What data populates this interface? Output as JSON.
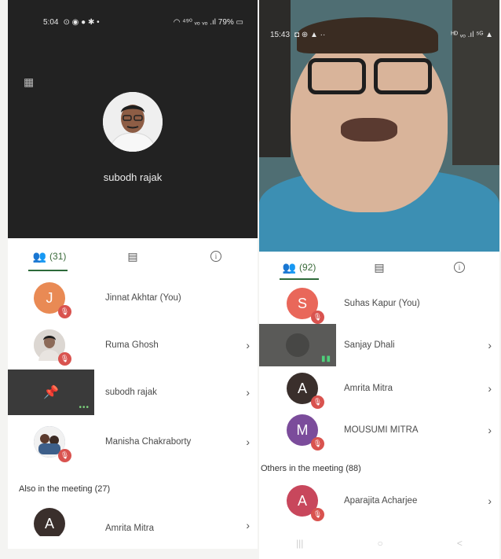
{
  "left_phone": {
    "status": {
      "time": "5:04",
      "icons_left": "⊙ ◉ ● ✱ •",
      "icons_right": "◠ ⁴⁹⁰ ᵥₒ ᵥₒ .ıl 79% ▭"
    },
    "presenter_name": "subodh rajak",
    "tabs": {
      "participants": "(31)"
    },
    "participants": [
      {
        "initial": "J",
        "name": "Jinnat Akhtar (You)",
        "color": "#e98a54"
      },
      {
        "initial": "",
        "name": "Ruma Ghosh",
        "color": "#d9d4cf"
      },
      {
        "initial": "",
        "name": "subodh rajak",
        "color": "#3a3a3a"
      },
      {
        "initial": "",
        "name": "Manisha Chakraborty",
        "color": "#6b7f9a"
      }
    ],
    "also_header": "Also in the meeting (27)",
    "partial_row": {
      "initial": "A",
      "name": "Amrita Mitra"
    }
  },
  "right_phone": {
    "status": {
      "time": "15:43",
      "icons_left": "◘ ⊕ ▲ ··",
      "icons_right": "ᴴᴰ ᵥₒ .ıl ⁵ᴳ ▲"
    },
    "tabs": {
      "participants": "(92)"
    },
    "participants": [
      {
        "initial": "S",
        "name": "Suhas Kapur (You)",
        "color": "#e9675a"
      },
      {
        "initial": "",
        "name": "Sanjay Dhali",
        "color": "#3a3a3a"
      },
      {
        "initial": "A",
        "name": "Amrita Mitra",
        "color": "#3a2f2c"
      },
      {
        "initial": "M",
        "name": "MOUSUMI MITRA",
        "color": "#7b4c9b"
      }
    ],
    "others_header": "Others in the meeting (88)",
    "others": [
      {
        "initial": "A",
        "name": "Aparajita Acharjee",
        "color": "#c8475c"
      }
    ],
    "nav": {
      "recents": "|||",
      "home": "○",
      "back": "<"
    }
  },
  "icons": {
    "participants": "participants-icon",
    "chat": "chat-icon",
    "info": "info-icon",
    "mic_off": "mic-off-icon",
    "chevron": "chevron-right-icon",
    "pin": "pin-icon"
  },
  "colors": {
    "accent": "#2d6a3a",
    "mic_off": "#d9534f"
  }
}
